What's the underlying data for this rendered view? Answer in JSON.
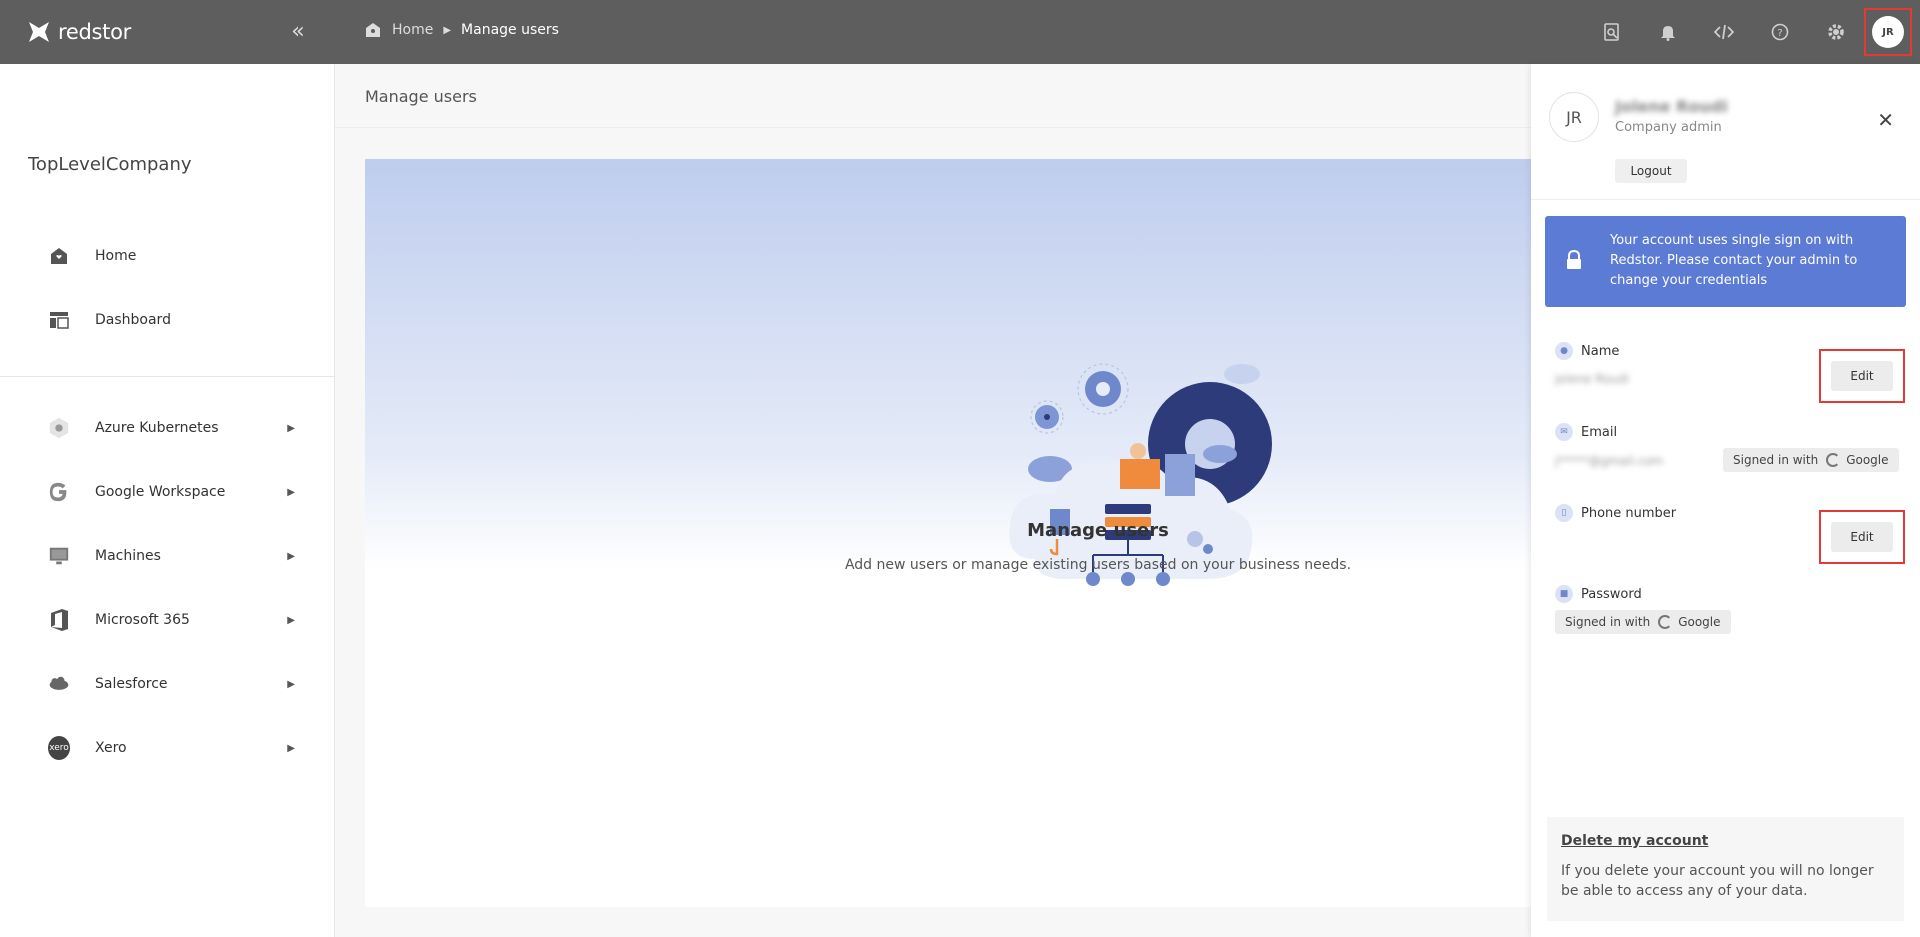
{
  "app": {
    "brand": "redstor"
  },
  "breadcrumb": {
    "home": "Home",
    "current": "Manage users"
  },
  "topbar": {
    "avatar_initials": "JR"
  },
  "sidebar": {
    "company": "TopLevelCompany",
    "primary": [
      {
        "label": "Home",
        "icon": "home-icon"
      },
      {
        "label": "Dashboard",
        "icon": "dashboard-icon"
      }
    ],
    "sources": [
      {
        "label": "Azure Kubernetes",
        "icon": "azure-kubernetes-icon"
      },
      {
        "label": "Google Workspace",
        "icon": "google-icon"
      },
      {
        "label": "Machines",
        "icon": "monitor-icon"
      },
      {
        "label": "Microsoft 365",
        "icon": "microsoft-office-icon"
      },
      {
        "label": "Salesforce",
        "icon": "salesforce-icon"
      },
      {
        "label": "Xero",
        "icon": "xero-icon"
      }
    ]
  },
  "main": {
    "page_title": "Manage users",
    "card_title": "Manage users",
    "card_description": "Add new users or manage existing users based on your business needs."
  },
  "profile": {
    "initials": "JR",
    "name": "Jolene Roudi",
    "role": "Company admin",
    "logout": "Logout",
    "sso_notice": "Your account uses single sign on with Redstor. Please contact your admin to change your credentials",
    "fields": {
      "name_label": "Name",
      "name_value": "Jolene Roudi",
      "email_label": "Email",
      "email_value": "j*****@gmail.com",
      "phone_label": "Phone number",
      "password_label": "Password"
    },
    "edit_label": "Edit",
    "signed_in_with": "Signed in with",
    "provider": "Google",
    "delete_link": "Delete my account",
    "delete_description": "If you delete your account you will no longer be able to access any of your data."
  },
  "colors": {
    "topbar": "#5e5e5e",
    "accent": "#5b7bd5",
    "highlight": "#e53935"
  }
}
